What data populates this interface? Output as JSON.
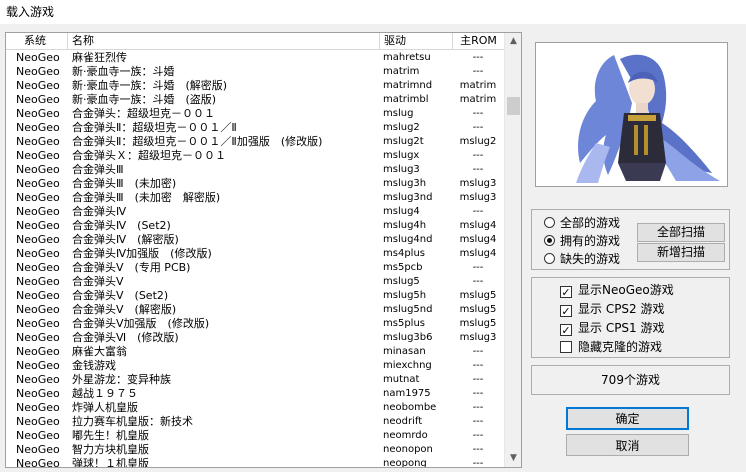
{
  "window": {
    "title": "载入游戏"
  },
  "list": {
    "columns": [
      "系统",
      "名称",
      "驱动",
      "主ROM"
    ],
    "rows": [
      {
        "system": "NeoGeo",
        "name": "麻雀狂烈传",
        "driver": "mahretsu",
        "rom": "---"
      },
      {
        "system": "NeoGeo",
        "name": "新·豪血寺一族：斗婚",
        "driver": "matrim",
        "rom": "---"
      },
      {
        "system": "NeoGeo",
        "name": "新·豪血寺一族：斗婚　(解密版)",
        "driver": "matrimnd",
        "rom": "matrim"
      },
      {
        "system": "NeoGeo",
        "name": "新·豪血寺一族：斗婚　(盗版)",
        "driver": "matrimbl",
        "rom": "matrim"
      },
      {
        "system": "NeoGeo",
        "name": "合金弹头：超级坦克－００１",
        "driver": "mslug",
        "rom": "---"
      },
      {
        "system": "NeoGeo",
        "name": "合金弹头Ⅱ：超级坦克－００１／Ⅱ",
        "driver": "mslug2",
        "rom": "---"
      },
      {
        "system": "NeoGeo",
        "name": "合金弹头Ⅱ：超级坦克－００１／Ⅱ加强版　(修改版)",
        "driver": "mslug2t",
        "rom": "mslug2"
      },
      {
        "system": "NeoGeo",
        "name": "合金弹头Ｘ：超级坦克－００１",
        "driver": "mslugx",
        "rom": "---"
      },
      {
        "system": "NeoGeo",
        "name": "合金弹头Ⅲ",
        "driver": "mslug3",
        "rom": "---"
      },
      {
        "system": "NeoGeo",
        "name": "合金弹头Ⅲ　(未加密)",
        "driver": "mslug3h",
        "rom": "mslug3"
      },
      {
        "system": "NeoGeo",
        "name": "合金弹头Ⅲ　(未加密　解密版)",
        "driver": "mslug3nd",
        "rom": "mslug3"
      },
      {
        "system": "NeoGeo",
        "name": "合金弹头Ⅳ",
        "driver": "mslug4",
        "rom": "---"
      },
      {
        "system": "NeoGeo",
        "name": "合金弹头Ⅳ　(Set2)",
        "driver": "mslug4h",
        "rom": "mslug4"
      },
      {
        "system": "NeoGeo",
        "name": "合金弹头Ⅳ　(解密版)",
        "driver": "mslug4nd",
        "rom": "mslug4"
      },
      {
        "system": "NeoGeo",
        "name": "合金弹头Ⅳ加强版　(修改版)",
        "driver": "ms4plus",
        "rom": "mslug4"
      },
      {
        "system": "NeoGeo",
        "name": "合金弹头Ⅴ　(专用 PCB)",
        "driver": "ms5pcb",
        "rom": "---"
      },
      {
        "system": "NeoGeo",
        "name": "合金弹头Ⅴ",
        "driver": "mslug5",
        "rom": "---"
      },
      {
        "system": "NeoGeo",
        "name": "合金弹头Ⅴ　(Set2)",
        "driver": "mslug5h",
        "rom": "mslug5"
      },
      {
        "system": "NeoGeo",
        "name": "合金弹头Ⅴ　(解密版)",
        "driver": "mslug5nd",
        "rom": "mslug5"
      },
      {
        "system": "NeoGeo",
        "name": "合金弹头Ⅴ加强版　(修改版)",
        "driver": "ms5plus",
        "rom": "mslug5"
      },
      {
        "system": "NeoGeo",
        "name": "合金弹头Ⅵ　(修改版)",
        "driver": "mslug3b6",
        "rom": "mslug3"
      },
      {
        "system": "NeoGeo",
        "name": "麻雀大富翁",
        "driver": "minasan",
        "rom": "---"
      },
      {
        "system": "NeoGeo",
        "name": "金钱游戏",
        "driver": "miexchng",
        "rom": "---"
      },
      {
        "system": "NeoGeo",
        "name": "外星游龙：变异种族",
        "driver": "mutnat",
        "rom": "---"
      },
      {
        "system": "NeoGeo",
        "name": "越战１９７５",
        "driver": "nam1975",
        "rom": "---"
      },
      {
        "system": "NeoGeo",
        "name": "炸弹人机皇版",
        "driver": "neobombe",
        "rom": "---"
      },
      {
        "system": "NeoGeo",
        "name": "拉力赛车机皇版：新技术",
        "driver": "neodrift",
        "rom": "---"
      },
      {
        "system": "NeoGeo",
        "name": "嘟先生！机皇版",
        "driver": "neomrdo",
        "rom": "---"
      },
      {
        "system": "NeoGeo",
        "name": "智力方块机皇版",
        "driver": "neonopon",
        "rom": "---"
      },
      {
        "system": "NeoGeo",
        "name": "弹球！１机皇版",
        "driver": "neopong",
        "rom": "---"
      }
    ]
  },
  "filter": {
    "options": [
      "全部的游戏",
      "拥有的游戏",
      "缺失的游戏"
    ],
    "selected_index": 1,
    "scan_all_label": "全部扫描",
    "scan_new_label": "新增扫描"
  },
  "display": {
    "items": [
      {
        "label": "显示NeoGeo游戏",
        "checked": true
      },
      {
        "label": "显示 CPS2 游戏",
        "checked": true
      },
      {
        "label": "显示 CPS1 游戏",
        "checked": true
      },
      {
        "label": "隐藏克隆的游戏",
        "checked": false
      }
    ]
  },
  "status": {
    "count_text": "709个游戏"
  },
  "actions": {
    "ok_label": "确定",
    "cancel_label": "取消"
  },
  "icons": {
    "scroll_up": "triangle-up-icon",
    "scroll_down": "triangle-down-icon",
    "check": "checkmark-icon"
  }
}
